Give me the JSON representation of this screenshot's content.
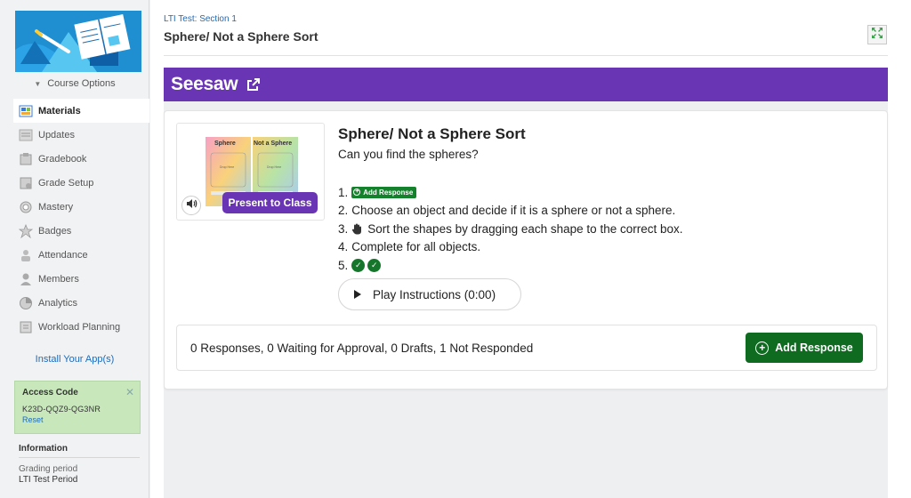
{
  "sidebar": {
    "course_options": "Course Options",
    "items": [
      {
        "label": "Materials",
        "icon": "materials-icon",
        "active": true
      },
      {
        "label": "Updates",
        "icon": "updates-icon"
      },
      {
        "label": "Gradebook",
        "icon": "gradebook-icon"
      },
      {
        "label": "Grade Setup",
        "icon": "grade-setup-icon"
      },
      {
        "label": "Mastery",
        "icon": "mastery-icon"
      },
      {
        "label": "Badges",
        "icon": "badges-icon"
      },
      {
        "label": "Attendance",
        "icon": "attendance-icon"
      },
      {
        "label": "Members",
        "icon": "members-icon"
      },
      {
        "label": "Analytics",
        "icon": "analytics-icon"
      },
      {
        "label": "Workload Planning",
        "icon": "workload-icon"
      }
    ],
    "install_link": "Install Your App(s)",
    "access": {
      "title": "Access Code",
      "code": "K23D-QQZ9-QG3NR",
      "reset": "Reset"
    },
    "info": {
      "title": "Information",
      "grading_label": "Grading period",
      "grading_value": "LTI Test Period"
    }
  },
  "header": {
    "breadcrumb": "LTI Test: Section 1",
    "title": "Sphere/ Not a Sphere Sort"
  },
  "seesaw": {
    "logo": "Seesaw"
  },
  "activity": {
    "thumbnail": {
      "left_label": "Sphere",
      "right_label": "Not a Sphere",
      "drop_label": "Drop Here"
    },
    "present_label": "Present to Class",
    "title": "Sphere/ Not a Sphere Sort",
    "subtitle": "Can you find the spheres?",
    "steps": [
      {
        "num": "1.",
        "add_label": "Add Response"
      },
      {
        "num": "2.",
        "text": "Choose an object and decide if it is a sphere or not a sphere."
      },
      {
        "num": "3.",
        "text": "Sort the shapes by dragging each shape to the correct box."
      },
      {
        "num": "4.",
        "text": "Complete for all objects."
      },
      {
        "num": "5."
      }
    ],
    "play_label": "Play Instructions (0:00)",
    "responses_summary": "0 Responses, 0 Waiting for Approval, 0 Drafts, 1 Not Responded",
    "add_response_label": "Add Response"
  },
  "colors": {
    "seesaw_purple": "#6a35b4",
    "add_green": "#0e6b20",
    "link_blue": "#1e6bb8",
    "access_bg": "#c8e8bc"
  }
}
